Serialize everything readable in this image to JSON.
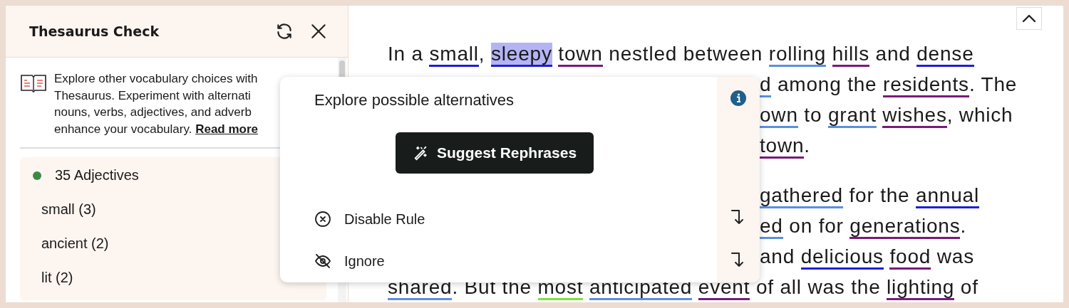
{
  "sidebar": {
    "title": "Thesaurus Check",
    "description_lines": [
      "Explore other vocabulary choices with",
      "Thesaurus. Experiment with alternati",
      "nouns, verbs, adjectives, and adverb",
      "enhance your vocabulary."
    ],
    "read_more_link": "Read more",
    "group": {
      "label": "35 Adjectives",
      "color": "#3a8a45",
      "items": [
        "small (3)",
        "ancient (2)",
        "lit (2)"
      ]
    }
  },
  "popup": {
    "title": "Explore possible alternatives",
    "button": "Suggest Rephrases",
    "actions": [
      {
        "kind": "disable",
        "label": "Disable Rule"
      },
      {
        "kind": "ignore",
        "label": "Ignore"
      }
    ]
  },
  "editor": {
    "paragraphs": [
      [
        {
          "covered": false,
          "segments": [
            {
              "kind": "text",
              "text": "In a "
            },
            {
              "kind": "word",
              "text": "small",
              "color": "#1f1fd6",
              "selected": false
            },
            {
              "kind": "text",
              "text": ", "
            },
            {
              "kind": "word",
              "text": "sleepy",
              "color": "#1f1fd6",
              "selected": true
            },
            {
              "kind": "word",
              "text": "town",
              "color": "#7a1a78",
              "selected": false
            },
            {
              "kind": "text",
              "text": " nestled between "
            },
            {
              "kind": "word",
              "text": "rolling",
              "color": "#5b8fe0",
              "selected": false
            },
            {
              "kind": "word",
              "text": "hills",
              "color": "#7a1a78",
              "selected": false
            },
            {
              "kind": "text",
              "text": " and "
            },
            {
              "kind": "word",
              "text": "dense",
              "color": "#1f1fd6",
              "selected": false
            }
          ]
        },
        {
          "covered": true,
          "segments": [
            {
              "kind": "word",
              "text": "d",
              "color": "#5b8fe0",
              "selected": false
            },
            {
              "kind": "text",
              "text": " among the "
            },
            {
              "kind": "word",
              "text": "residents",
              "color": "#7a1a78",
              "selected": false
            },
            {
              "kind": "text",
              "text": ". The"
            }
          ]
        },
        {
          "covered": true,
          "segments": [
            {
              "kind": "word",
              "text": "own",
              "color": "#5b8fe0",
              "selected": false
            },
            {
              "kind": "text",
              "text": " to "
            },
            {
              "kind": "word",
              "text": "grant",
              "color": "#5b8fe0",
              "selected": false
            },
            {
              "kind": "word",
              "text": "wishes",
              "color": "#7a1a78",
              "selected": false
            },
            {
              "kind": "text",
              "text": ", which"
            }
          ]
        },
        {
          "covered": true,
          "segments": [
            {
              "kind": "word",
              "text": "town",
              "color": "#7a1a78",
              "selected": false
            },
            {
              "kind": "text",
              "text": "."
            }
          ]
        }
      ],
      [
        {
          "covered": true,
          "segments": [
            {
              "kind": "word",
              "text": "gathered",
              "color": "#5b8fe0",
              "selected": false
            },
            {
              "kind": "text",
              "text": " for the "
            },
            {
              "kind": "word",
              "text": "annual",
              "color": "#1f1fd6",
              "selected": false
            }
          ]
        },
        {
          "covered": true,
          "segments": [
            {
              "kind": "word",
              "text": "ed",
              "color": "#5b8fe0",
              "selected": false
            },
            {
              "kind": "text",
              "text": " on for "
            },
            {
              "kind": "word",
              "text": "generations",
              "color": "#7a1a78",
              "selected": false
            },
            {
              "kind": "text",
              "text": "."
            }
          ]
        },
        {
          "covered": true,
          "segments": [
            {
              "kind": "text",
              "text": "and "
            },
            {
              "kind": "word",
              "text": "delicious",
              "color": "#1f1fd6",
              "selected": false
            },
            {
              "kind": "word",
              "text": "food",
              "color": "#7a1a78",
              "selected": false
            },
            {
              "kind": "text",
              "text": " was"
            }
          ]
        },
        {
          "covered": false,
          "segments": [
            {
              "kind": "word",
              "text": "shared",
              "color": "#5b8fe0",
              "selected": false
            },
            {
              "kind": "text",
              "text": ". But the "
            },
            {
              "kind": "word",
              "text": "most",
              "color": "#7ee03c",
              "selected": false
            },
            {
              "kind": "word",
              "text": "anticipated",
              "color": "#5b8fe0",
              "selected": false
            },
            {
              "kind": "word",
              "text": "event",
              "color": "#7a1a78",
              "selected": false
            },
            {
              "kind": "text",
              "text": " of all was the "
            },
            {
              "kind": "word",
              "text": "lighting",
              "color": "#7a1a78",
              "selected": false
            },
            {
              "kind": "text",
              "text": " of"
            }
          ]
        }
      ]
    ]
  }
}
